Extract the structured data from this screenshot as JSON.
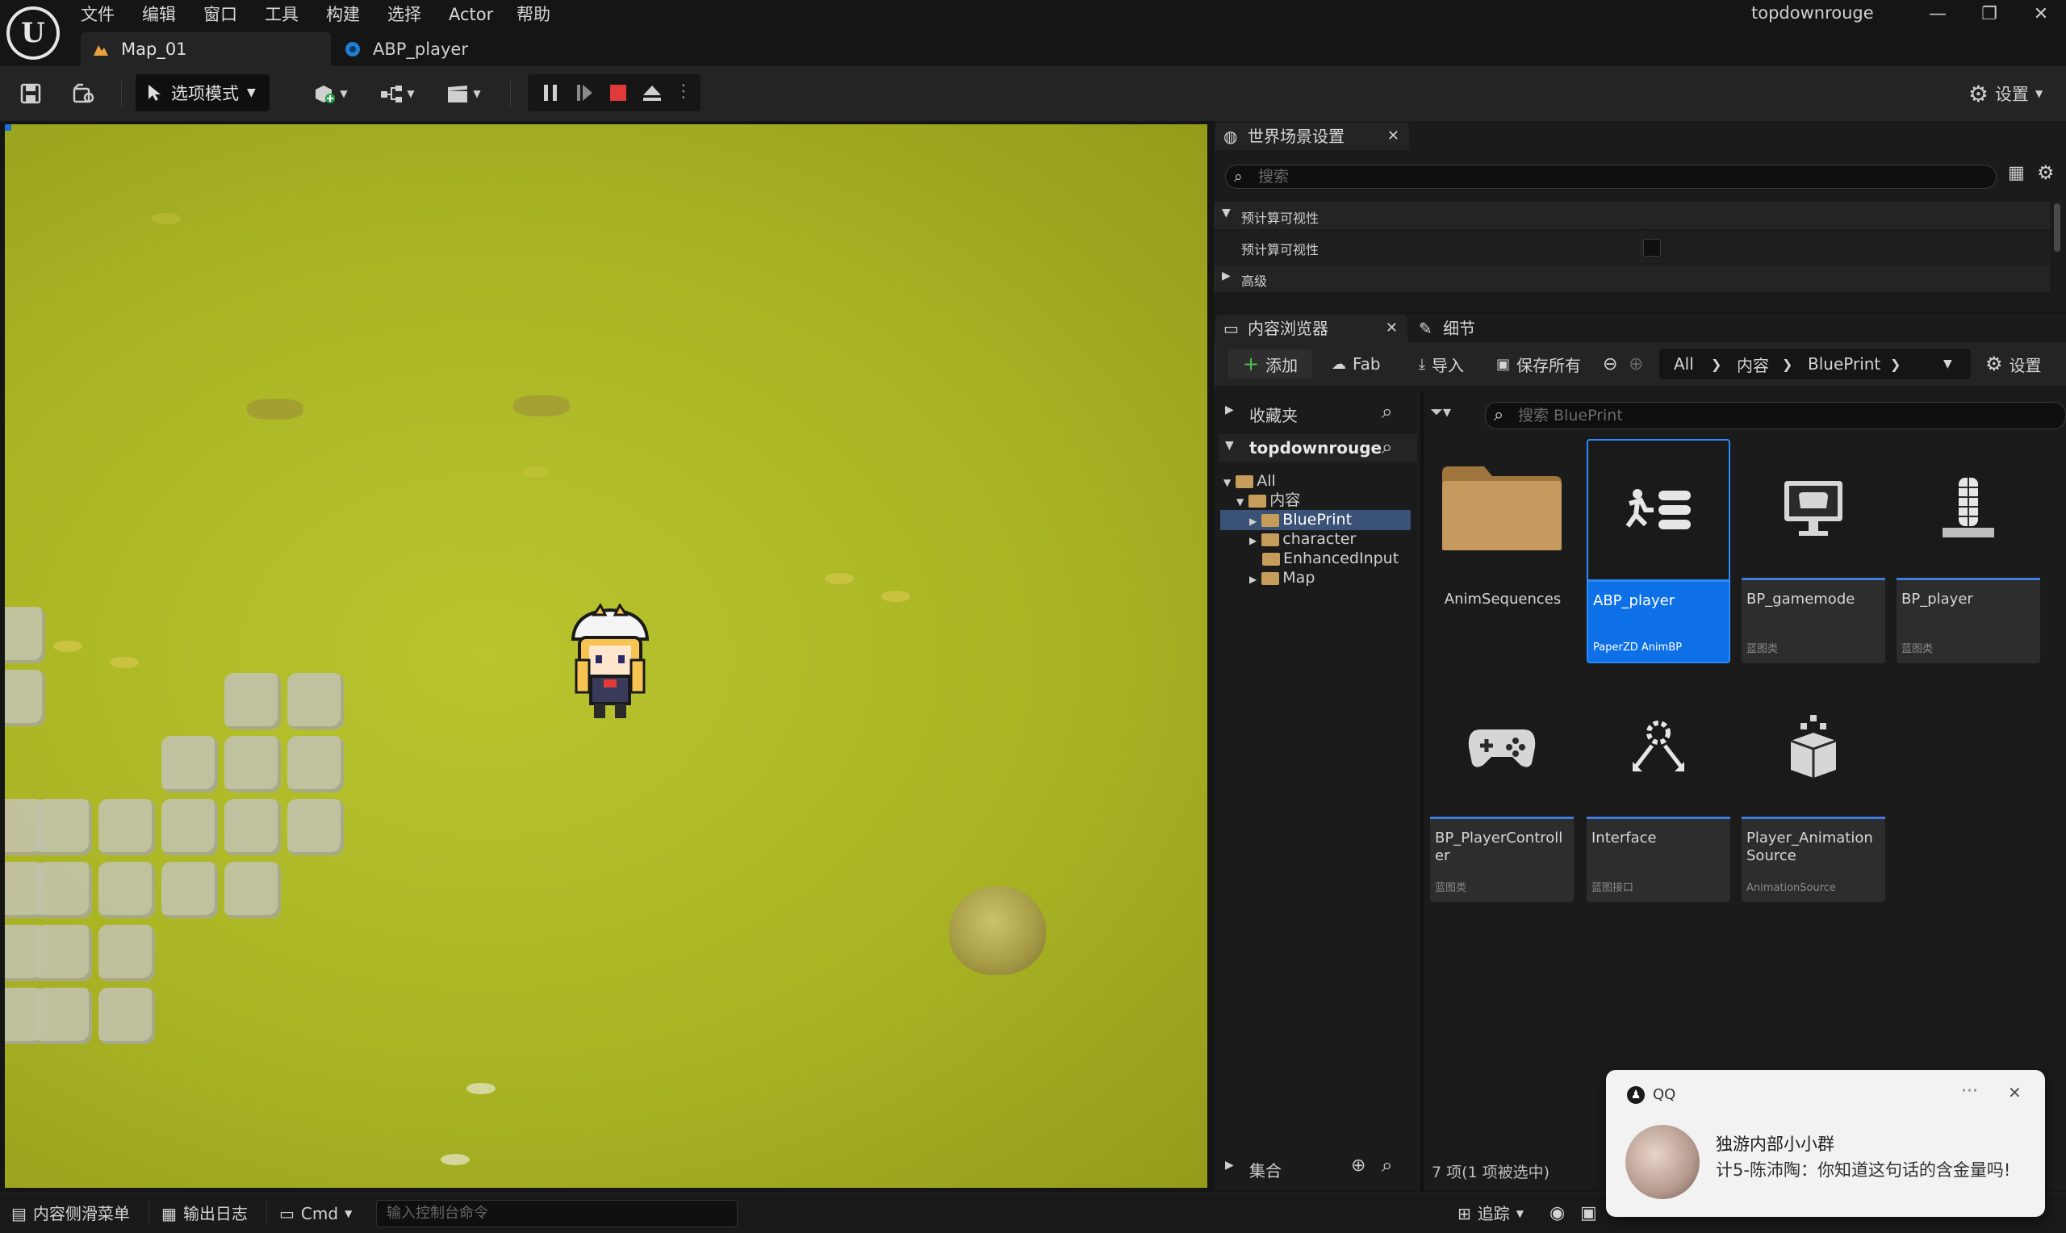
{
  "menu": [
    "文件",
    "编辑",
    "窗口",
    "工具",
    "构建",
    "选择",
    "Actor",
    "帮助"
  ],
  "project_name": "topdownrouge",
  "tabs": [
    {
      "label": "Map_01"
    },
    {
      "label": "ABP_player"
    }
  ],
  "toolbar": {
    "mode_label": "选项模式",
    "settings_label": "设置"
  },
  "world_settings": {
    "tab_label": "世界场景设置",
    "search_placeholder": "搜索",
    "section_precomputed": "预计算可视性",
    "row_precomputed": "预计算可视性",
    "section_advanced": "高级"
  },
  "content_browser": {
    "tab_label": "内容浏览器",
    "details_tab_label": "细节",
    "add_label": "添加",
    "fab_label": "Fab",
    "import_label": "导入",
    "save_all_label": "保存所有",
    "settings_label": "设置",
    "breadcrumb": [
      "All",
      "内容",
      "BluePrint"
    ],
    "favorites_label": "收藏夹",
    "project_label": "topdownrouge",
    "collections_label": "集合",
    "search_placeholder": "搜索 BluePrint",
    "tree": [
      {
        "label": "All",
        "level": 0
      },
      {
        "label": "内容",
        "level": 1
      },
      {
        "label": "BluePrint",
        "level": 2
      },
      {
        "label": "character",
        "level": 2
      },
      {
        "label": "EnhancedInput",
        "level": 2
      },
      {
        "label": "Map",
        "level": 2
      }
    ],
    "assets": [
      {
        "name": "AnimSequences",
        "type": "",
        "icon": "folder-icon"
      },
      {
        "name": "ABP_player",
        "type": "PaperZD AnimBP",
        "icon": "anim-blueprint-icon",
        "selected": true
      },
      {
        "name": "BP_gamemode",
        "type": "蓝图类",
        "icon": "gamemode-icon"
      },
      {
        "name": "BP_player",
        "type": "蓝图类",
        "icon": "pawn-icon"
      },
      {
        "name": "BP_PlayerController",
        "type": "蓝图类",
        "icon": "gamepad-icon"
      },
      {
        "name": "Interface",
        "type": "蓝图接口",
        "icon": "interface-icon"
      },
      {
        "name": "Player_Animation Source",
        "type": "AnimationSource",
        "icon": "animation-source-icon"
      }
    ],
    "status": "7 项(1 项被选中)"
  },
  "statusbar": {
    "content_drawer": "内容侧滑菜单",
    "output_log": "输出日志",
    "cmd": "Cmd",
    "console_placeholder": "输入控制台命令",
    "trace": "追踪"
  },
  "toast": {
    "app": "QQ",
    "title": "独游内部小小群",
    "message": "计5-陈沛陶：你知道这句话的含金量吗!"
  },
  "colors": {
    "accent": "#0e70e6",
    "grass": "#aab526",
    "stop": "#e03a3a"
  }
}
